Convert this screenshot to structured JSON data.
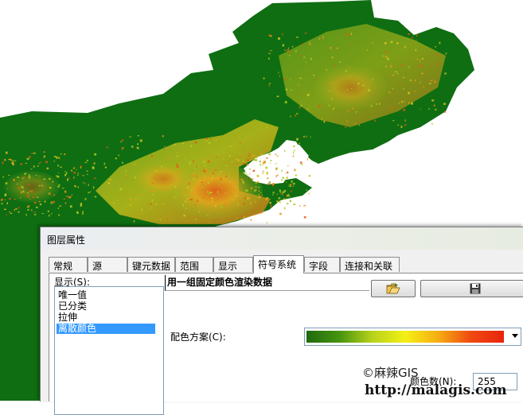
{
  "dialog": {
    "title": "图层属性",
    "tabs": [
      {
        "label": "常规"
      },
      {
        "label": "源"
      },
      {
        "label": "键元数据"
      },
      {
        "label": "范围"
      },
      {
        "label": "显示"
      },
      {
        "label": "符号系统",
        "active": true
      },
      {
        "label": "字段"
      },
      {
        "label": "连接和关联"
      }
    ]
  },
  "symbology": {
    "show_label": "显示(S):",
    "show_items": [
      {
        "label": "唯一值"
      },
      {
        "label": "已分类"
      },
      {
        "label": "拉伸"
      },
      {
        "label": "离散颜色",
        "selected": true
      }
    ],
    "description": "用一组固定颜色渲染数据",
    "color_scheme_label": "配色方案(C):",
    "color_scheme_ramp": [
      "#1f6b0e",
      "#47950f",
      "#b6d21b",
      "#f3f015",
      "#f6ac12",
      "#ef4b10",
      "#e8240e"
    ],
    "color_count_label": "颜色数(N):",
    "color_count_value": "255"
  },
  "toolbar_icons": {
    "open": "open-folder-icon",
    "save": "save-disk-icon"
  },
  "watermark": {
    "line1": "©麻辣GIS",
    "line2": "http://malagis.com"
  },
  "colors": {
    "land_green": "#0f6e12",
    "sea": "#ffffff",
    "selection": "#3399ff"
  }
}
